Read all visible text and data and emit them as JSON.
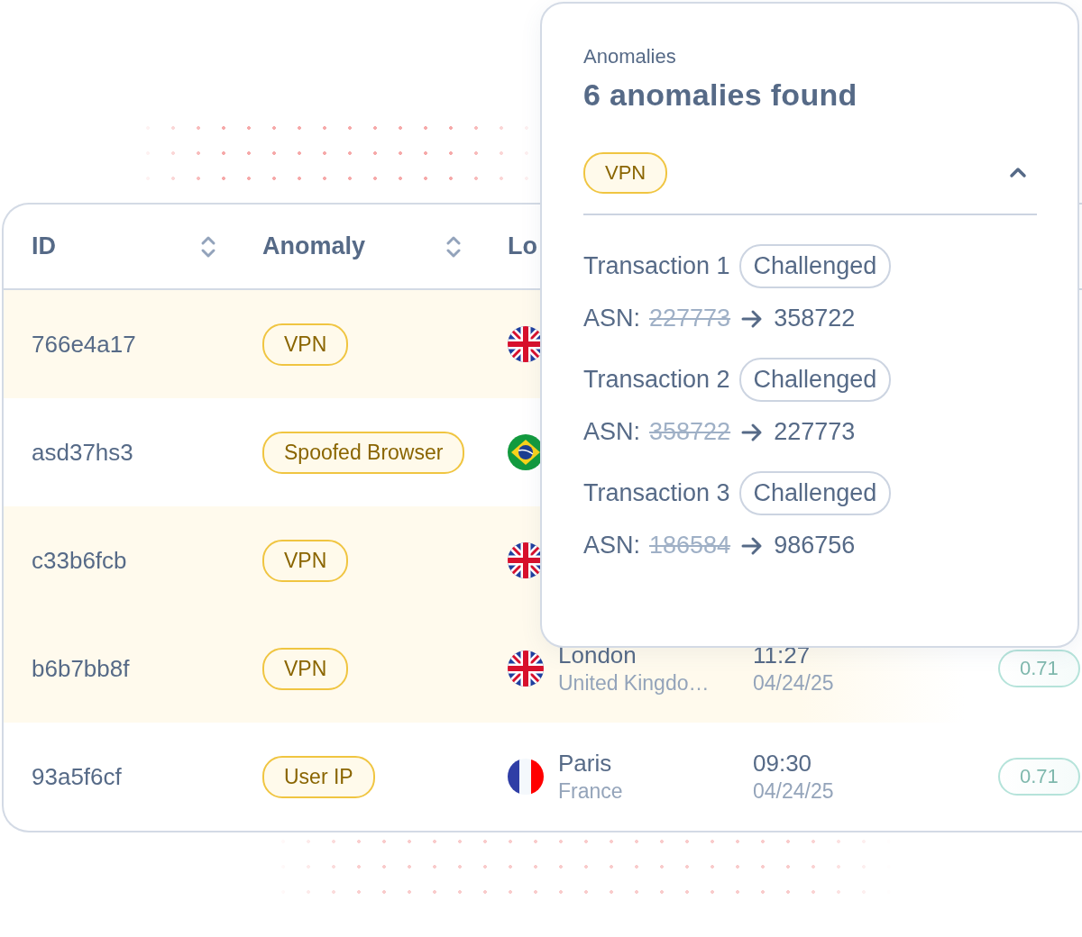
{
  "table": {
    "columns": [
      {
        "label": "ID",
        "sortable": true
      },
      {
        "label": "Anomaly",
        "sortable": true
      },
      {
        "label": "Lo",
        "sortable": false
      }
    ],
    "rows": [
      {
        "id": "766e4a17",
        "anomaly": "VPN",
        "highlighted": true,
        "flag": {
          "kind": "gb"
        }
      },
      {
        "id": "asd37hs3",
        "anomaly": "Spoofed Browser",
        "highlighted": false,
        "flag": {
          "kind": "br"
        }
      },
      {
        "id": "c33b6fcb",
        "anomaly": "VPN",
        "highlighted": true,
        "flag": {
          "kind": "gb"
        }
      },
      {
        "id": "b6b7bb8f",
        "anomaly": "VPN",
        "highlighted": true,
        "flag": {
          "kind": "gb"
        },
        "city": "London",
        "country": "United Kingdo…",
        "time": "11:27",
        "date": "04/24/25",
        "score": "0.71"
      },
      {
        "id": "93a5f6cf",
        "anomaly": "User IP",
        "highlighted": false,
        "flag": {
          "kind": "fr"
        },
        "city": "Paris",
        "country": "France",
        "time": "09:30",
        "date": "04/24/25",
        "score": "0.71"
      }
    ]
  },
  "popover": {
    "subtitle": "Anomalies",
    "title": "6 anomalies found",
    "group": {
      "label": "VPN",
      "expanded": true
    },
    "transactions": [
      {
        "label": "Transaction 1",
        "status": "Challenged",
        "asn_label": "ASN:",
        "asn_old": "227773",
        "asn_new": "358722"
      },
      {
        "label": "Transaction 2",
        "status": "Challenged",
        "asn_label": "ASN:",
        "asn_old": "358722",
        "asn_new": "227773"
      },
      {
        "label": "Transaction 3",
        "status": "Challenged",
        "asn_label": "ASN:",
        "asn_old": "186584",
        "asn_new": "986756"
      }
    ]
  }
}
